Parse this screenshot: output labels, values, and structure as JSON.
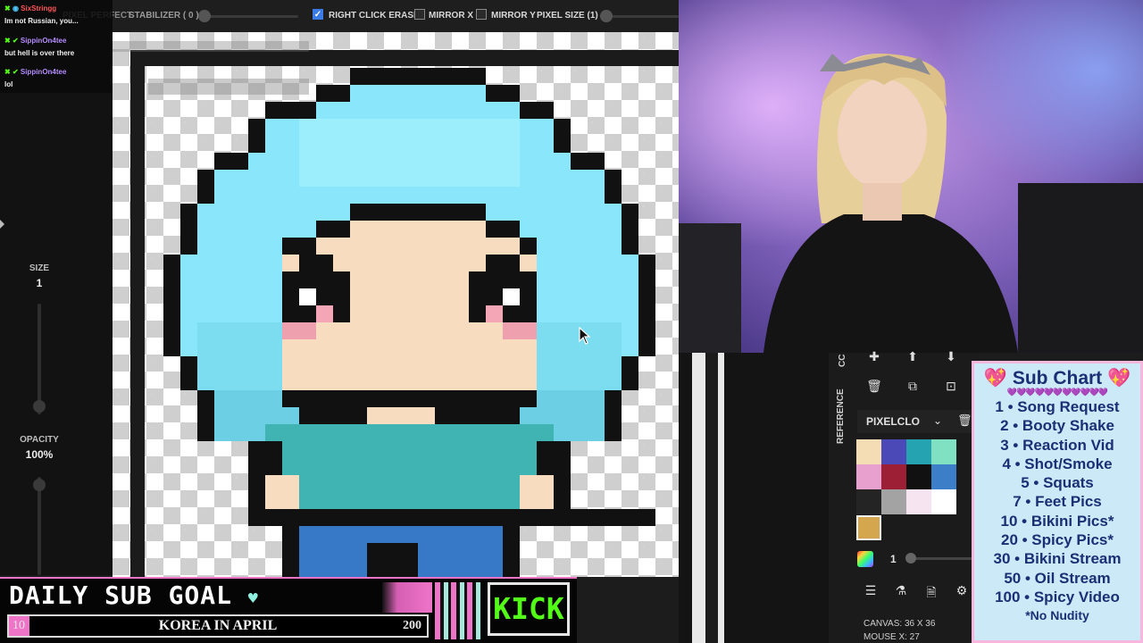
{
  "chat": {
    "messages": [
      {
        "user": "SixStringg",
        "text": "Im not Russian, you..."
      },
      {
        "user": "SippinOn4tee",
        "text": "but hell is over there"
      },
      {
        "user": "SippinOn4tee",
        "text": "lol"
      }
    ]
  },
  "toolbar": {
    "pixel_perfect": "PIXEL PERFECT",
    "stabilizer": "STABILIZER ( 0 )",
    "right_click_erase": "RIGHT CLICK ERASE",
    "right_click_erase_checked": true,
    "mirror_x": "MIRROR X",
    "mirror_y": "MIRROR Y",
    "pixel_size": "PIXEL SIZE (1)"
  },
  "left_panel": {
    "size_label": "SIZE",
    "size_value": "1",
    "opacity_label": "OPACITY",
    "opacity_value": "100%"
  },
  "right_panel": {
    "vertical_label_1": "CC",
    "reference_label": "REFERENCE",
    "palette_name": "PIXELCLO",
    "palette_colors": [
      "#f4dcb4",
      "#4b48b8",
      "#25a3b1",
      "#7fe0c2",
      "#e8a0cf",
      "#9c1f36",
      "#111111",
      "#3c7ec8",
      "#242424",
      "#a3a3a3",
      "#f6e5f1",
      "#ffffff",
      "#d4a74e"
    ],
    "brush_size": "1",
    "canvas_info": "CANVAS: 36 X 36",
    "mouse_info": "MOUSE X: 27"
  },
  "sub_chart": {
    "title": "Sub Chart",
    "items": [
      "1 • Song Request",
      "2 • Booty Shake",
      "3 • Reaction Vid",
      "4 • Shot/Smoke",
      "5 • Squats",
      "7 • Feet Pics",
      "10 • Bikini Pics*",
      "20 • Spicy Pics*",
      "30 • Bikini Stream",
      "50 • Oil Stream",
      "100 • Spicy Video"
    ],
    "note": "*No Nudity"
  },
  "sub_goal": {
    "title": "DAILY SUB GOAL",
    "current": "10",
    "label": "KOREA IN APRIL",
    "target": "200",
    "progress_fraction": 0.05
  },
  "kick": {
    "label": "KICK"
  },
  "colors": {
    "hair_light": "#8ae6fb",
    "hair_mid": "#7cdcf0",
    "hair_dark": "#6ccfe3",
    "skin": "#f8dcc0",
    "shirt": "#3fb4b2",
    "pants": "#3779c7",
    "outline": "#111111",
    "sub_chart_text": "#1b2f74",
    "sub_chart_border": "#f8b6dd",
    "goal_pink": "#ee74c8",
    "kick_green": "#53fc18"
  }
}
